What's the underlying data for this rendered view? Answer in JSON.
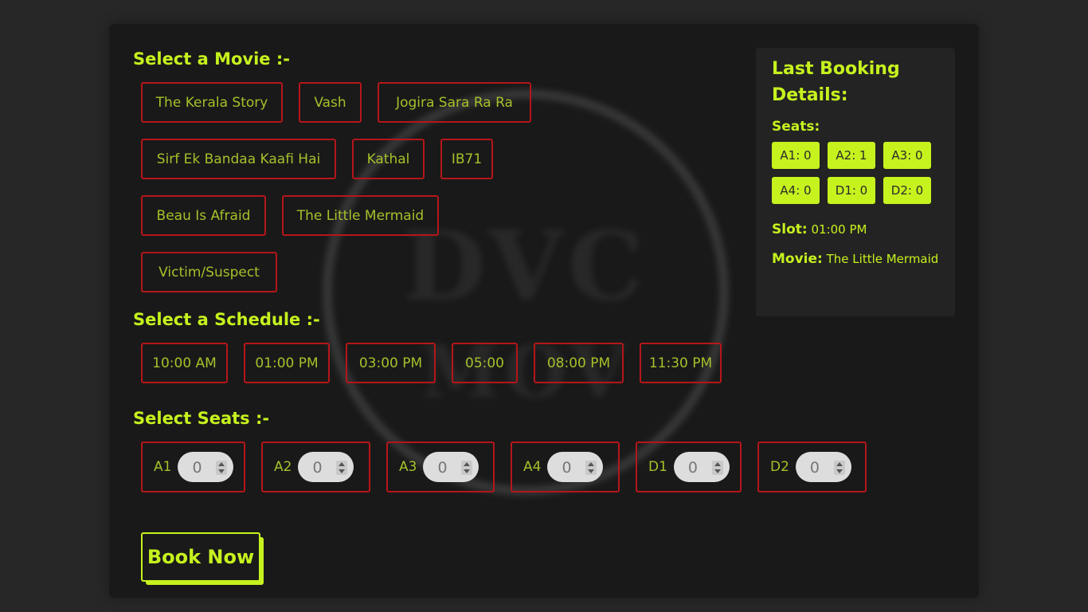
{
  "sections": {
    "movie_title": "Select a Movie :-",
    "schedule_title": "Select a Schedule :-",
    "seats_title": "Select Seats :-"
  },
  "movies": [
    "The Kerala Story",
    "Vash",
    "Jogira Sara Ra Ra",
    "Sirf Ek Bandaa Kaafi Hai",
    "Kathal",
    "IB71",
    "Beau Is Afraid",
    "The Little Mermaid",
    "Victim/Suspect"
  ],
  "schedules": [
    "10:00 AM",
    "01:00 PM",
    "03:00 PM",
    "05:00",
    "08:00 PM",
    "11:30 PM"
  ],
  "seats": [
    {
      "label": "A1",
      "value": "0"
    },
    {
      "label": "A2",
      "value": "0"
    },
    {
      "label": "A3",
      "value": "0"
    },
    {
      "label": "A4",
      "value": "0"
    },
    {
      "label": "D1",
      "value": "0"
    },
    {
      "label": "D2",
      "value": "0"
    }
  ],
  "book_button": "Book Now",
  "last_booking": {
    "title": "Last Booking Details:",
    "seats_label": "Seats:",
    "seats": [
      "A1: 0",
      "A2: 1",
      "A3: 0",
      "A4: 0",
      "D1: 0",
      "D2: 0"
    ],
    "slot_label": "Slot:",
    "slot_value": "01:00 PM",
    "movie_label": "Movie:",
    "movie_value": "The Little Mermaid"
  },
  "colors": {
    "accent": "#c6f21e",
    "chip_border": "#b5161a",
    "chip_text": "#a4c12a",
    "background": "#191919"
  }
}
